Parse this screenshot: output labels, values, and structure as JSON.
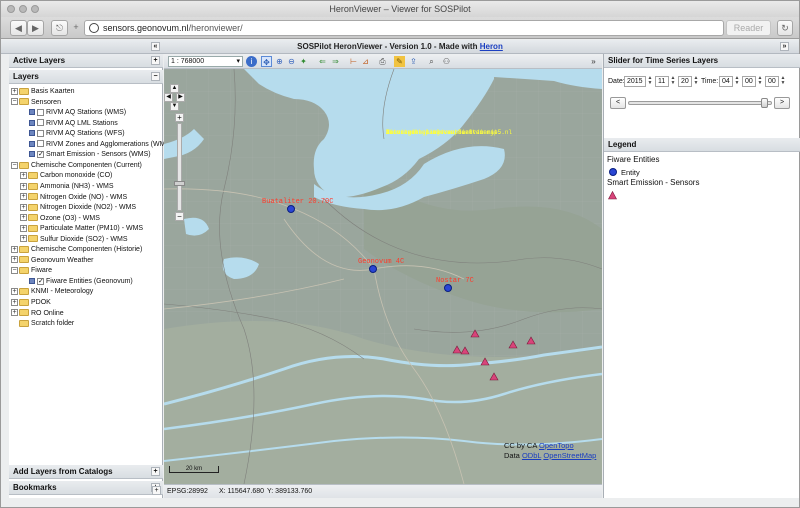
{
  "browser": {
    "window_title": "HeronViewer – Viewer for SOSPilot",
    "back_glyph": "◀",
    "forward_glyph": "▶",
    "share_glyph": "⎋",
    "new_tab_glyph": "+",
    "url_host": "sensors.geonovum.nl",
    "url_path": "/heronviewer/",
    "reader_label": "Reader",
    "refresh_glyph": "↻"
  },
  "app": {
    "title_prefix": "SOSPilot HeronViewer - Version 1.0 - Made with ",
    "title_link": "Heron",
    "collapse_left": "«",
    "collapse_right": "»"
  },
  "left_panel": {
    "active_layers_title": "Active Layers",
    "layers_title": "Layers",
    "add_layers_title": "Add Layers from Catalogs",
    "bookmarks_title": "Bookmarks",
    "tree": [
      {
        "label": "Basis Kaarten",
        "type": "folder",
        "expand": "+",
        "indent": 0
      },
      {
        "label": "Sensoren",
        "type": "folder",
        "expand": "−",
        "indent": 0
      },
      {
        "label": "RIVM AQ Stations (WMS)",
        "type": "layer",
        "checked": false,
        "indent": 2
      },
      {
        "label": "RIVM AQ LML Stations",
        "type": "layer",
        "checked": false,
        "indent": 2
      },
      {
        "label": "RIVM AQ Stations (WFS)",
        "type": "layer",
        "checked": false,
        "indent": 2
      },
      {
        "label": "RIVM Zones and Agglomerations (WMS",
        "type": "layer",
        "checked": false,
        "indent": 2
      },
      {
        "label": "Smart Emission - Sensors (WMS)",
        "type": "layer",
        "checked": true,
        "indent": 2
      },
      {
        "label": "Chemische Componenten (Current)",
        "type": "folder",
        "expand": "−",
        "indent": 0
      },
      {
        "label": "Carbon monoxide (CO)",
        "type": "folder",
        "expand": "+",
        "indent": 1
      },
      {
        "label": "Ammonia (NH3) - WMS",
        "type": "folder",
        "expand": "+",
        "indent": 1
      },
      {
        "label": "Nitrogen Oxide (NO) - WMS",
        "type": "folder",
        "expand": "+",
        "indent": 1
      },
      {
        "label": "Nitrogen Dioxide (NO2) - WMS",
        "type": "folder",
        "expand": "+",
        "indent": 1
      },
      {
        "label": "Ozone (O3) - WMS",
        "type": "folder",
        "expand": "+",
        "indent": 1
      },
      {
        "label": "Particulate Matter (PM10) - WMS",
        "type": "folder",
        "expand": "+",
        "indent": 1
      },
      {
        "label": "Sulfur Dioxide (SO2) - WMS",
        "type": "folder",
        "expand": "+",
        "indent": 1
      },
      {
        "label": "Chemische Componenten (Historie)",
        "type": "folder",
        "expand": "+",
        "indent": 0
      },
      {
        "label": "Geonovum Weather",
        "type": "folder",
        "expand": "+",
        "indent": 0
      },
      {
        "label": "Fiware",
        "type": "folder",
        "expand": "−",
        "indent": 0
      },
      {
        "label": "Fiware Entities (Geonovum)",
        "type": "layer",
        "checked": true,
        "indent": 2
      },
      {
        "label": "KNMI - Meteorology",
        "type": "folder",
        "expand": "+",
        "indent": 0
      },
      {
        "label": "PDOK",
        "type": "folder",
        "expand": "+",
        "indent": 0
      },
      {
        "label": "RO Online",
        "type": "folder",
        "expand": "+",
        "indent": 0
      },
      {
        "label": "Scratch folder",
        "type": "folder",
        "expand": "",
        "indent": 0
      }
    ]
  },
  "map_toolbar": {
    "scale_value": "1 : 768000",
    "expand_glyph": "»"
  },
  "map": {
    "scalebar_label": "20 km",
    "attribution_prefix": "CC by CA ",
    "attribution_link1": "OpenTopo",
    "attribution_data": "Data ",
    "attribution_link2": "ODbL",
    "attribution_link3": "OpenStreetMap",
    "labels": [
      "Buataliter 20.70C",
      "Geonovum 4C",
      "Nostar 7C"
    ],
    "yellow_lines": [
      "Stuur gr!",
      "Dit is de gratis versie van map5.nl",
      "Voor een betaalde abbo Steun je",
      "de ontwikkeling van deze dienst.",
      "Aanvragen op www.map5.nl"
    ]
  },
  "statusbar": {
    "epsg": "EPSG:28992",
    "x": "X: 115647.680",
    "y": "Y: 389133.760"
  },
  "right_panel": {
    "timeslider_title": "Slider for Time Series Layers",
    "date_label": "Date:",
    "year": "2015",
    "month": "11",
    "day": "20",
    "time_label": "Time:",
    "hour": "04",
    "minute": "00",
    "second": "00",
    "prev_label": "<",
    "next_label": ">",
    "slider_position": 0.97,
    "legend_title": "Legend",
    "legend_fiware": "Fiware Entities",
    "legend_entity": "Entity",
    "legend_smart": "Smart Emission - Sensors"
  }
}
